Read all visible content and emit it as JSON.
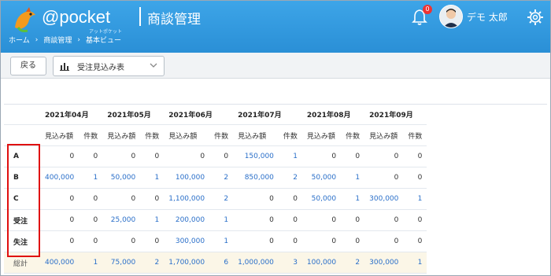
{
  "header": {
    "brand": "@pocket",
    "brand_sub": "アットポケット",
    "app_title": "商談管理",
    "notification_count": "0",
    "user_name": "デモ 太郎"
  },
  "breadcrumb": [
    "ホーム",
    "›",
    "商談管理",
    "›",
    "基本ビュー"
  ],
  "toolbar": {
    "back_label": "戻る",
    "view_select_value": "受注見込み表"
  },
  "table": {
    "months": [
      "2021年04月",
      "2021年05月",
      "2021年06月",
      "2021年07月",
      "2021年08月",
      "2021年09月"
    ],
    "sub_headers": [
      "見込み額",
      "件数"
    ],
    "rows": [
      {
        "label": "A",
        "cells": [
          "0",
          "0",
          "0",
          "0",
          "0",
          "0",
          "150,000",
          "1",
          "0",
          "0",
          "0",
          "0"
        ]
      },
      {
        "label": "B",
        "cells": [
          "400,000",
          "1",
          "50,000",
          "1",
          "100,000",
          "2",
          "850,000",
          "2",
          "50,000",
          "1",
          "0",
          "0"
        ]
      },
      {
        "label": "C",
        "cells": [
          "0",
          "0",
          "0",
          "0",
          "1,100,000",
          "2",
          "0",
          "0",
          "50,000",
          "1",
          "300,000",
          "1"
        ]
      },
      {
        "label": "受注",
        "cells": [
          "0",
          "0",
          "25,000",
          "1",
          "200,000",
          "1",
          "0",
          "0",
          "0",
          "0",
          "0",
          "0"
        ]
      },
      {
        "label": "失注",
        "cells": [
          "0",
          "0",
          "0",
          "0",
          "300,000",
          "1",
          "0",
          "0",
          "0",
          "0",
          "0",
          "0"
        ]
      }
    ],
    "total": {
      "label": "総計",
      "cells": [
        "400,000",
        "1",
        "75,000",
        "2",
        "1,700,000",
        "6",
        "1,000,000",
        "3",
        "100,000",
        "2",
        "300,000",
        "1"
      ]
    }
  },
  "colors": {
    "header_blue": "#2a8fd6",
    "link_blue": "#2a6fc9",
    "highlight_red": "#e01010",
    "total_row_bg": "#fbf6e7"
  },
  "icons": [
    "bird-logo-icon",
    "bell-icon",
    "gear-icon",
    "bar-chart-icon",
    "chevron-down-icon"
  ]
}
